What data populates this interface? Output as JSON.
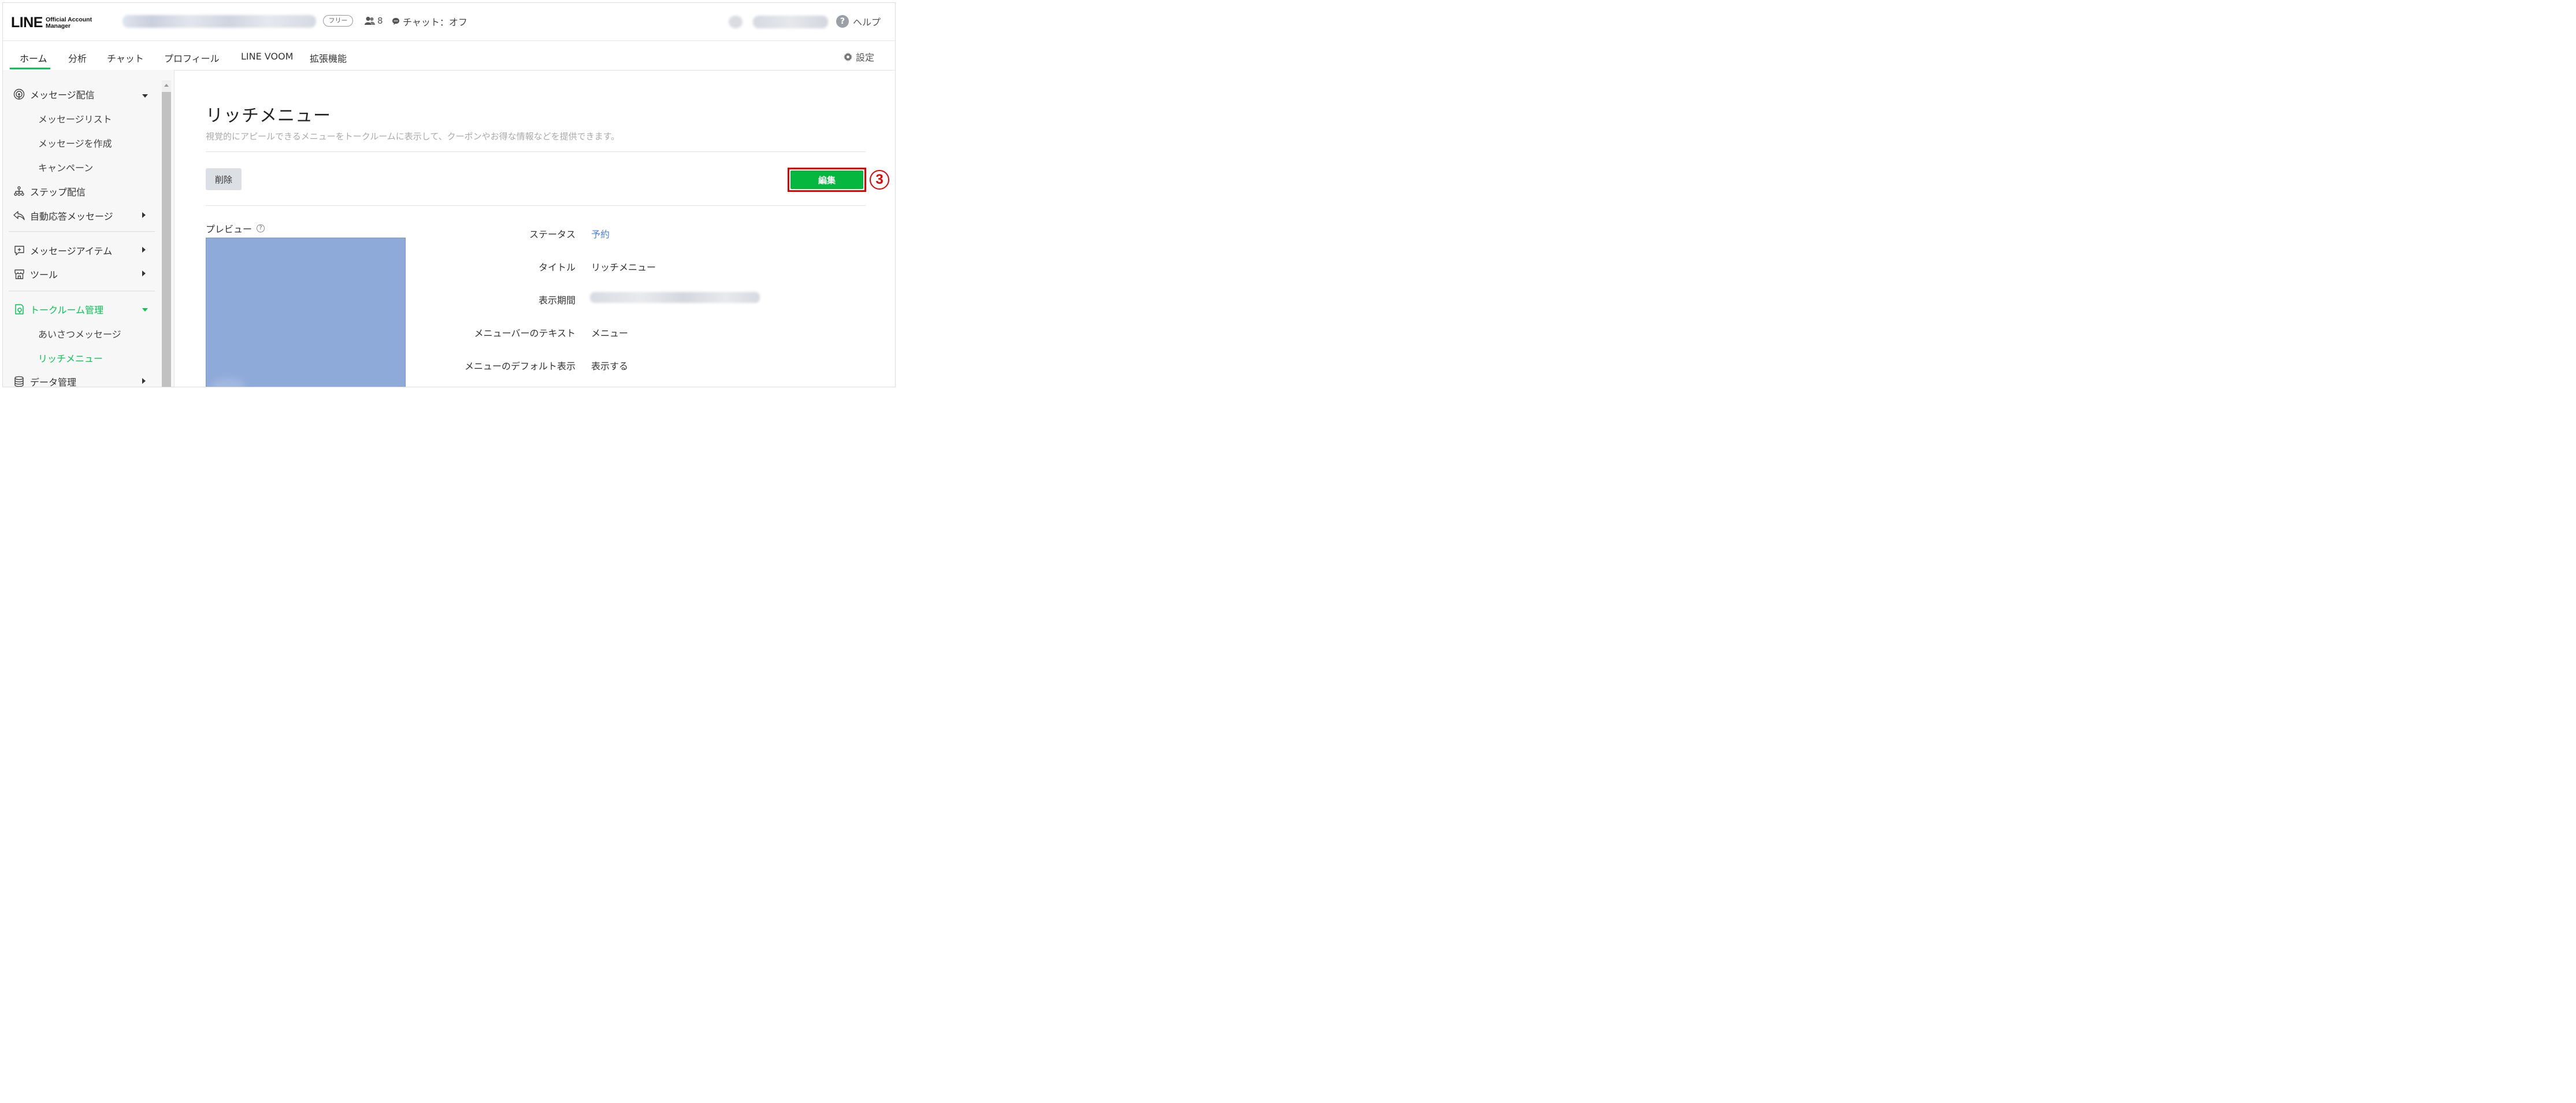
{
  "header": {
    "logo_word": "LINE",
    "logo_sub_line1": "Official Account",
    "logo_sub_line2": "Manager",
    "plan_badge": "フリー",
    "friend_count": "8",
    "chat_status": "チャット：オフ",
    "help_label": "ヘルプ"
  },
  "nav": {
    "tabs": [
      "ホーム",
      "分析",
      "チャット",
      "プロフィール",
      "LINE VOOM",
      "拡張機能"
    ],
    "active_tab": "ホーム",
    "settings_label": "設定"
  },
  "sidebar": {
    "message_delivery": "メッセージ配信",
    "message_list": "メッセージリスト",
    "create_message": "メッセージを作成",
    "campaign": "キャンペーン",
    "step_delivery": "ステップ配信",
    "auto_reply": "自動応答メッセージ",
    "message_items": "メッセージアイテム",
    "tools": "ツール",
    "talkroom_mgmt": "トークルーム管理",
    "greeting_message": "あいさつメッセージ",
    "rich_menu": "リッチメニュー",
    "data_mgmt": "データ管理"
  },
  "main": {
    "title": "リッチメニュー",
    "description": "視覚的にアピールできるメニューをトークルームに表示して、クーポンやお得な情報などを提供できます。",
    "delete_button": "削除",
    "edit_button": "編集",
    "step_marker": "③",
    "preview_label": "プレビュー",
    "preview_help": "?",
    "details": {
      "status_label": "ステータス",
      "status_value": "予約",
      "title_label": "タイトル",
      "title_value": "リッチメニュー",
      "period_label": "表示期間",
      "menubar_text_label": "メニューバーのテキスト",
      "menubar_text_value": "メニュー",
      "default_display_label": "メニューのデフォルト表示",
      "default_display_value": "表示する"
    }
  },
  "colors": {
    "line_green": "#06c755",
    "edit_button_green": "#06b73f",
    "highlight_red": "#e60000",
    "link_blue": "#4a7fd4",
    "preview_blue": "#8eaad9"
  }
}
